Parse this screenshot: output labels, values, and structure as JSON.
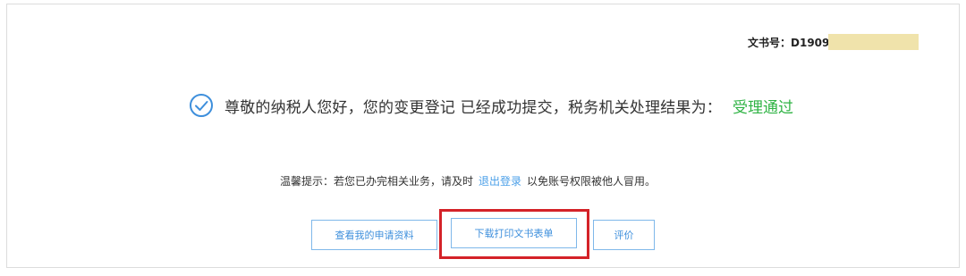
{
  "doc_number": {
    "label": "文书号：",
    "value": "D190920"
  },
  "success": {
    "icon": "check-circle-icon",
    "message": "尊敬的纳税人您好，您的变更登记 已经成功提交，税务机关处理结果为：",
    "result": "受理通过"
  },
  "tip": {
    "prefix": "温馨提示：若您已办完相关业务，请及时",
    "link": "退出登录",
    "suffix": "以免账号权限被他人冒用。"
  },
  "buttons": {
    "view": "查看我的申请资料",
    "download": "下载打印文书表单",
    "rate": "评价"
  },
  "colors": {
    "accent": "#3e8fdc",
    "success": "#2fb344",
    "highlight": "#d42228",
    "redaction": "#f0e3ab"
  }
}
